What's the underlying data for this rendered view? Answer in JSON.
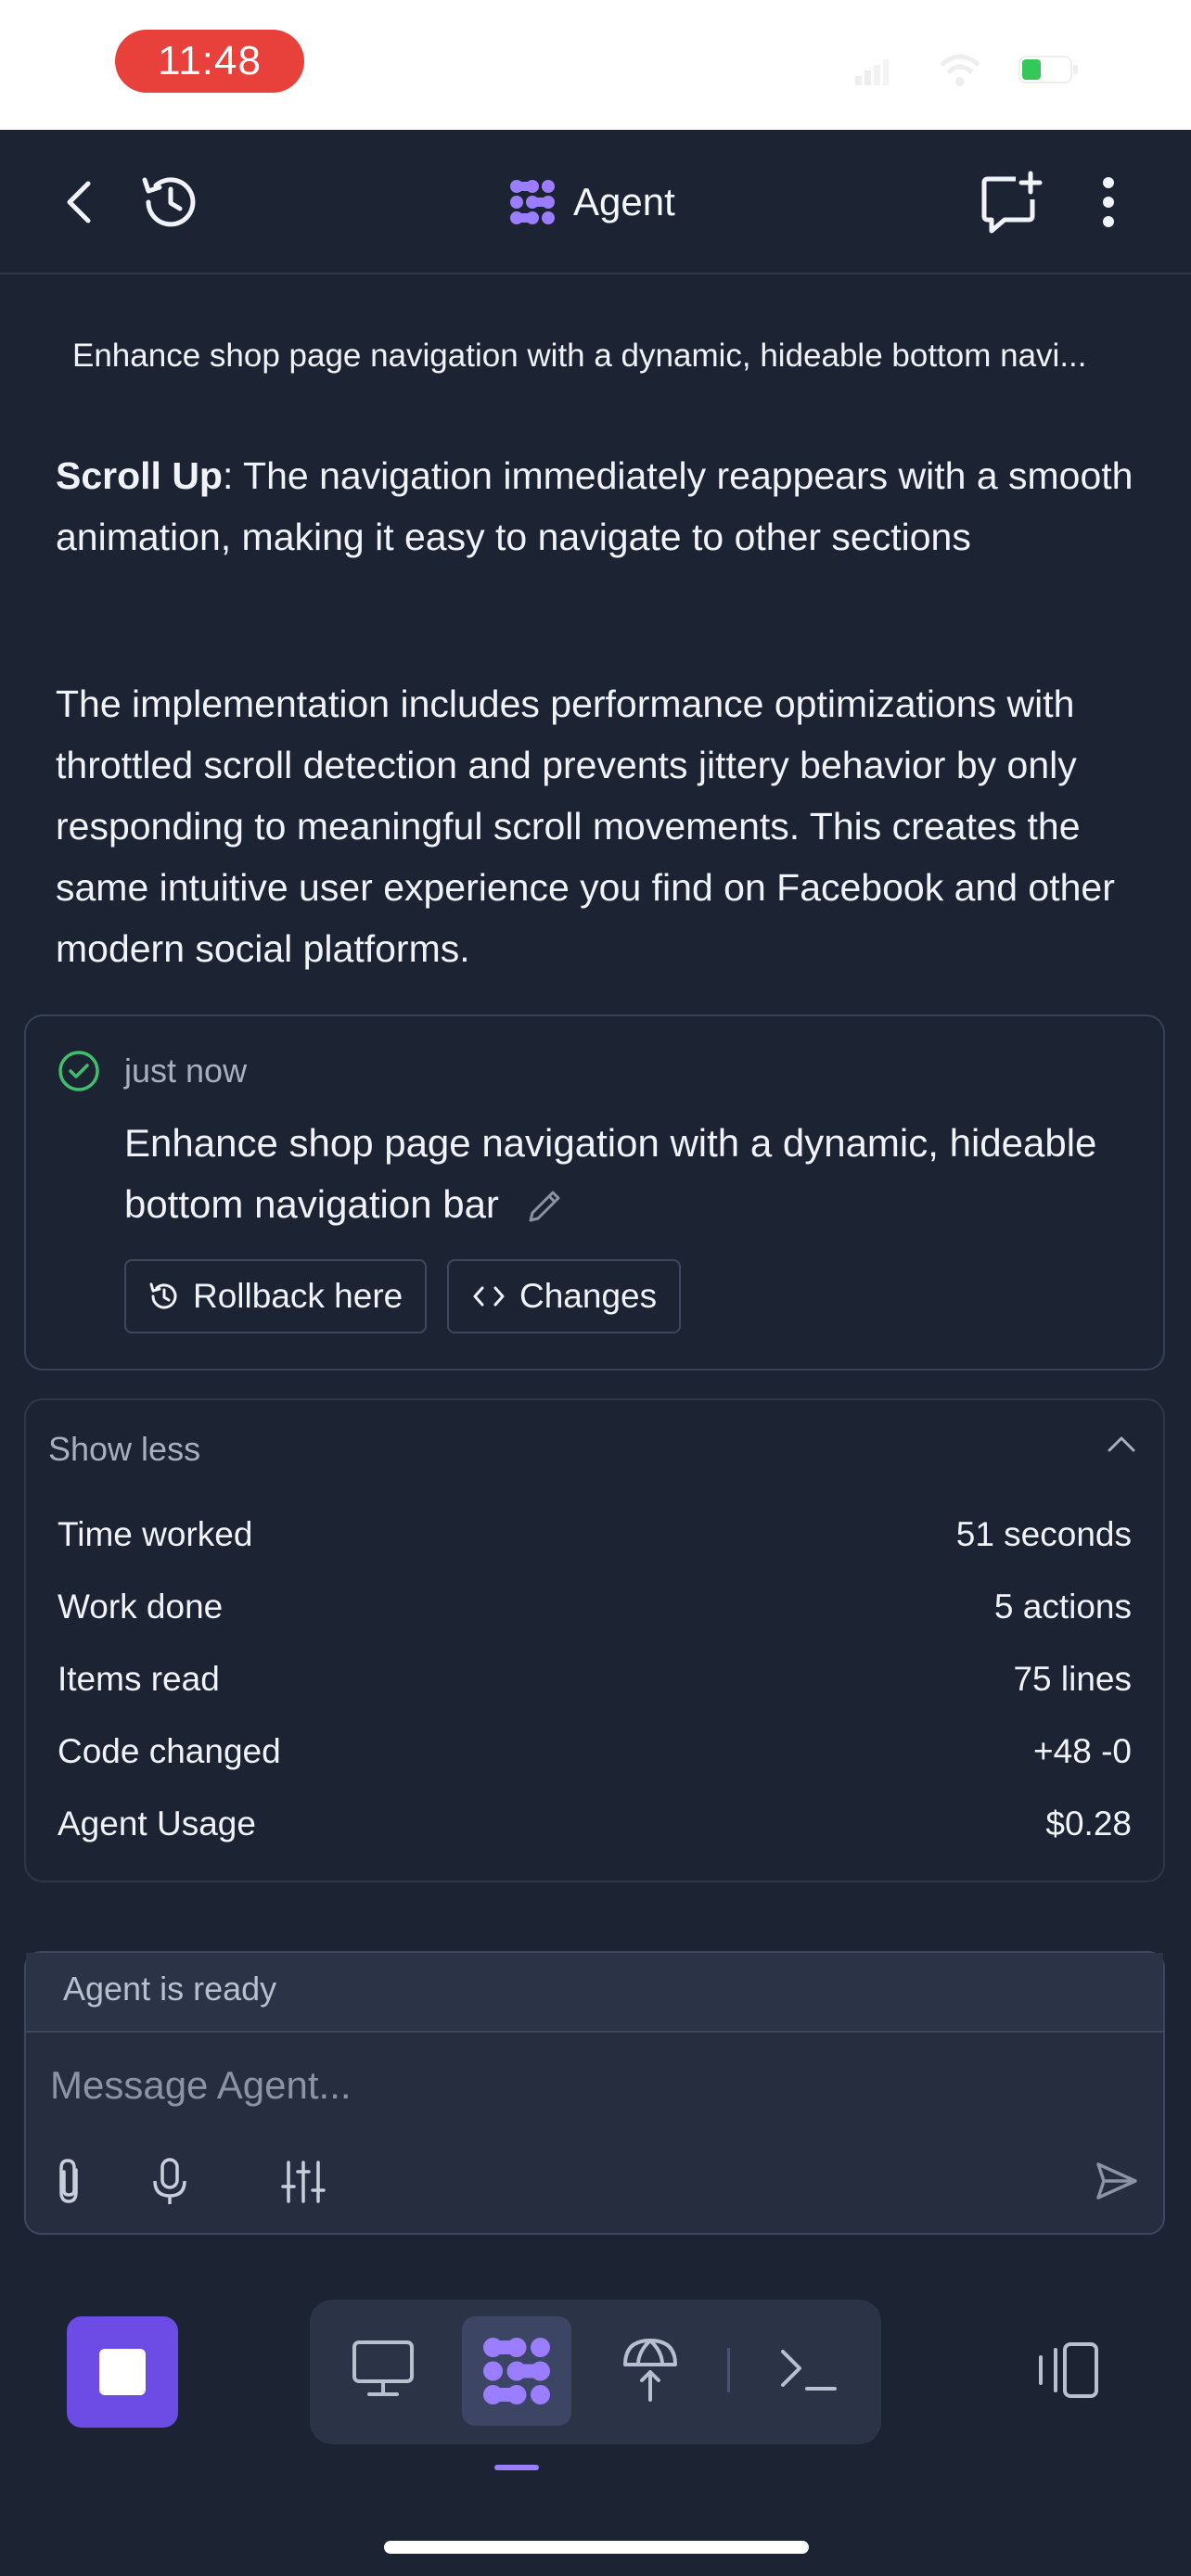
{
  "status_bar": {
    "time": "11:48"
  },
  "header": {
    "title": "Agent"
  },
  "thread": {
    "title": "Enhance shop page navigation with a dynamic, hideable bottom navi...",
    "paragraph1_bold": "Scroll Up",
    "paragraph1_rest": ": The navigation immediately reappears with a smooth animation, making it easy to navigate to other sections",
    "paragraph2": "The implementation includes performance optimizations with throttled scroll detection and prevents jittery behavior by only responding to meaningful scroll movements. This creates the same intuitive user experience you find on Facebook and other modern social platforms."
  },
  "checkpoint": {
    "time": "just now",
    "text": "Enhance shop page navigation with a dynamic, hideable bottom navigation bar",
    "rollback_label": "Rollback here",
    "changes_label": "Changes"
  },
  "stats": {
    "toggle_label": "Show less",
    "rows": [
      {
        "label": "Time worked",
        "value": "51 seconds"
      },
      {
        "label": "Work done",
        "value": "5 actions"
      },
      {
        "label": "Items read",
        "value": "75 lines"
      },
      {
        "label": "Code changed",
        "value": "+48 -0"
      },
      {
        "label": "Agent Usage",
        "value": "$0.28"
      }
    ]
  },
  "composer": {
    "status": "Agent is ready",
    "placeholder": "Message Agent..."
  },
  "colors": {
    "background": "#1c2333",
    "accent": "#6d4ce6",
    "agent_icon": "#9b7dff",
    "success": "#3fbf6b"
  }
}
